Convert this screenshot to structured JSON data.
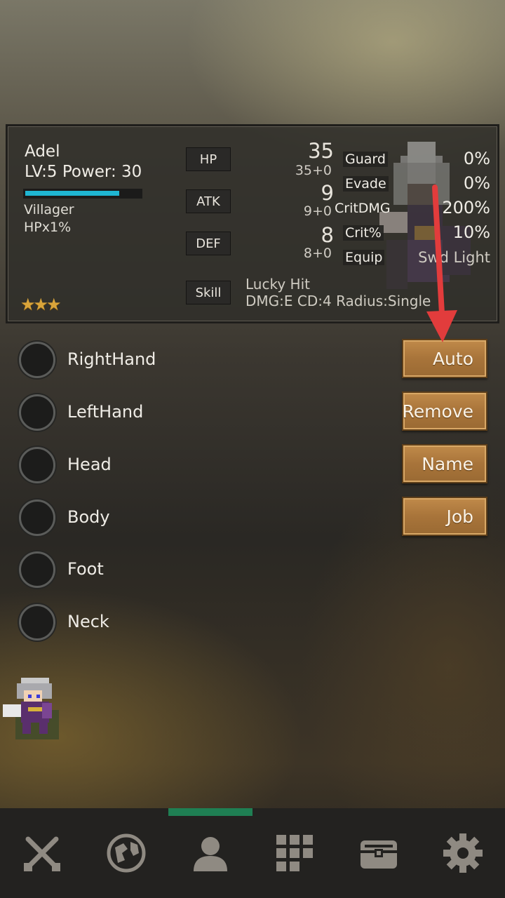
{
  "character": {
    "name": "Adel",
    "level_power": "LV:5 Power: 30",
    "hp_fraction": 0.82,
    "job": "Villager",
    "job_bonus": "HPx1%",
    "stars": "★★★",
    "stars_count": 3
  },
  "stats": [
    {
      "label": "HP",
      "value": "35",
      "detail": "35+0"
    },
    {
      "label": "ATK",
      "value": "9",
      "detail": "9+0"
    },
    {
      "label": "DEF",
      "value": "8",
      "detail": "8+0"
    }
  ],
  "right_stats": [
    {
      "label": "Guard",
      "value": "0%"
    },
    {
      "label": "Evade",
      "value": "0%"
    },
    {
      "label": "CritDMG",
      "value": "200%"
    },
    {
      "label": "Crit%",
      "value": "10%"
    },
    {
      "label": "Equip",
      "value": "Swd Light"
    }
  ],
  "skill": {
    "label": "Skill",
    "name": "Lucky Hit",
    "description": "DMG:E CD:4 Radius:Single"
  },
  "slots": [
    "RightHand",
    "LeftHand",
    "Head",
    "Body",
    "Foot",
    "Neck"
  ],
  "buttons": {
    "auto": "Auto",
    "remove": "Remove",
    "name": "Name",
    "job": "Job"
  },
  "nav": {
    "items": [
      "battle-icon",
      "world-icon",
      "character-icon",
      "grid-icon",
      "chest-icon",
      "settings-icon"
    ],
    "active_index": 2,
    "active_color": "#1f7f53"
  },
  "colors": {
    "hp_bar": "#1fb6d2",
    "button": "#a8743a",
    "arrow": "#e23c3c",
    "stars": "#d9a43a"
  }
}
